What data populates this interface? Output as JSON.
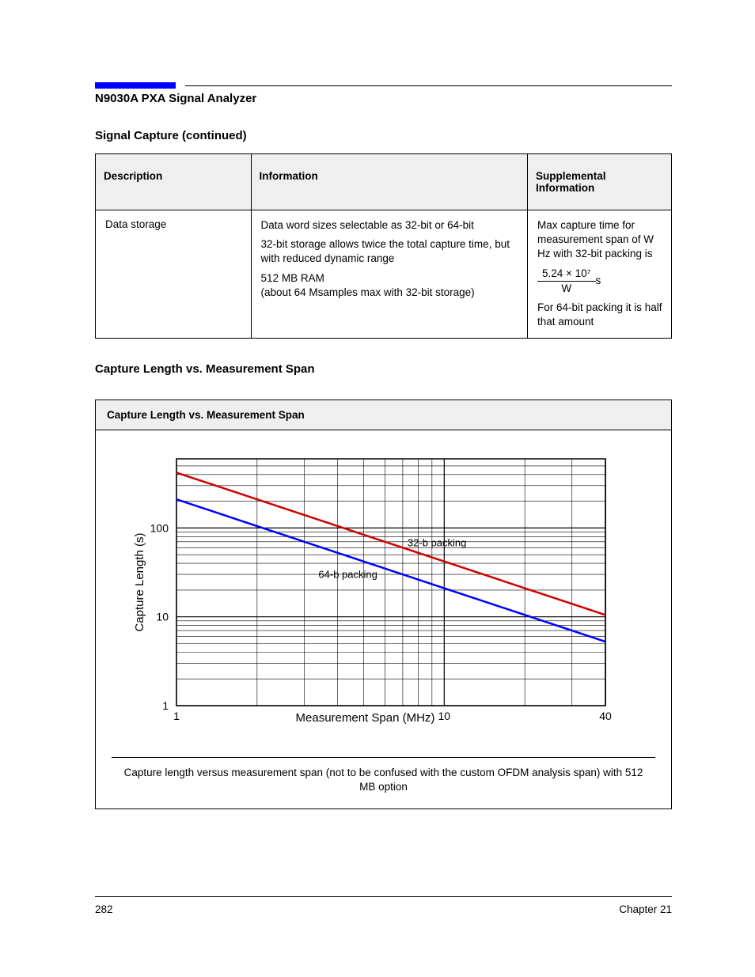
{
  "header": {
    "title": "N9030A PXA Signal Analyzer"
  },
  "table_section_label": "Signal Capture (continued)",
  "table": {
    "headers": [
      "Description",
      "Information",
      "Supplemental Information"
    ],
    "row": {
      "desc": "Data storage",
      "info": {
        "l1": "Data word sizes selectable as 32-bit or 64-bit",
        "l2": "32-bit storage allows twice the total capture time, but with reduced dynamic range",
        "l3": "512 MB RAM",
        "l4": "(about 64 Msamples max with 32-bit storage)"
      },
      "supp": {
        "l1": "Max capture time for measurement span of W Hz with 32-bit packing is",
        "frac_top": "5.24 × 10⁷",
        "frac_bot": "W",
        "unit": " s",
        "l2": "For 64-bit packing it is half that amount"
      }
    }
  },
  "chart_section_label": "Capture Length vs. Measurement Span",
  "chart_panel_title": "Capture Length vs. Measurement Span",
  "chart_data": {
    "type": "line",
    "xlabel": "Measurement Span (MHz)",
    "ylabel": "Capture Length (s)",
    "xlim": [
      1,
      40
    ],
    "ylim": [
      1,
      600
    ],
    "xscale": "log",
    "yscale": "log",
    "series": [
      {
        "name": "32-b packing",
        "color": "#d00000",
        "x": [
          1,
          2,
          5,
          10,
          20,
          40
        ],
        "values": [
          420,
          210,
          84,
          42,
          21,
          10.5
        ]
      },
      {
        "name": "64-b packing",
        "color": "#0000ff",
        "x": [
          1,
          2,
          5,
          10,
          20,
          40
        ],
        "values": [
          210,
          105,
          42,
          21,
          10.5,
          5.25
        ]
      }
    ],
    "label_positions": {
      "32b": "32-b packing",
      "64b": "64-b packing"
    }
  },
  "chart_caption": "Capture length versus measurement span (not to be confused with the\ncustom OFDM analysis span) with 512 MB option",
  "footer": {
    "left": "282",
    "right": "Chapter 21"
  }
}
